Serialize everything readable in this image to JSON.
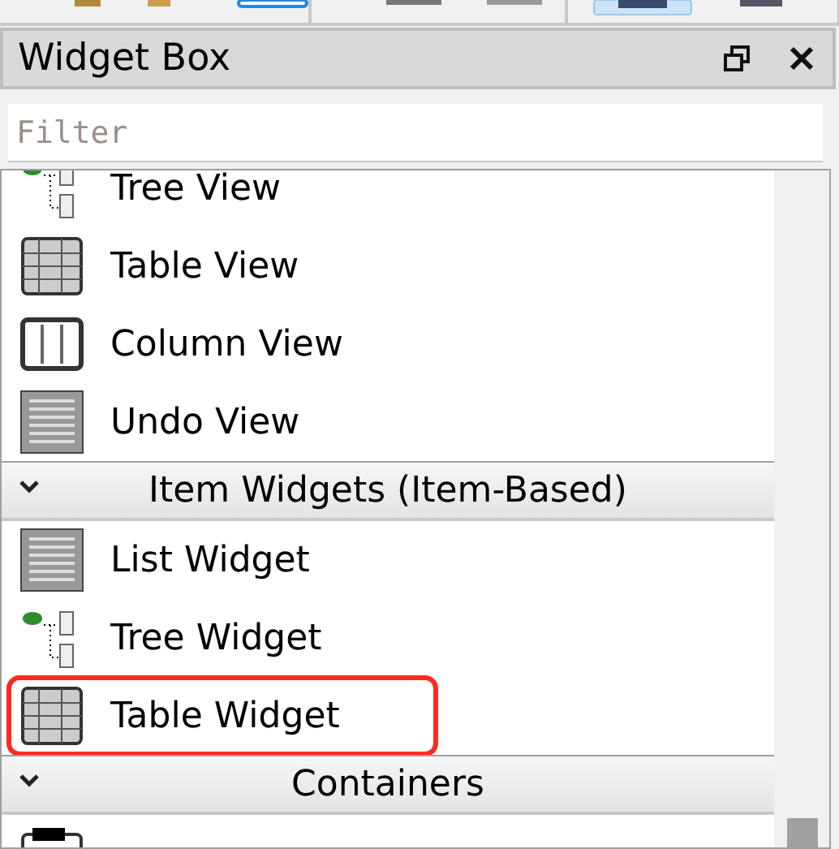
{
  "dock": {
    "title": "Widget Box"
  },
  "filter": {
    "placeholder": "Filter"
  },
  "items": [
    {
      "kind": "tree",
      "label": "Tree View",
      "highlighted": false
    },
    {
      "kind": "table",
      "label": "Table View",
      "highlighted": false
    },
    {
      "kind": "column",
      "label": "Column View",
      "highlighted": false
    },
    {
      "kind": "list",
      "label": "Undo View",
      "highlighted": false
    },
    {
      "kind": "category",
      "label": "Item Widgets (Item-Based)",
      "expanded": true
    },
    {
      "kind": "list",
      "label": "List Widget",
      "highlighted": false
    },
    {
      "kind": "tree",
      "label": "Tree Widget",
      "highlighted": false
    },
    {
      "kind": "table",
      "label": "Table Widget",
      "highlighted": true
    },
    {
      "kind": "category",
      "label": "Containers",
      "expanded": true
    },
    {
      "kind": "group"
    }
  ]
}
